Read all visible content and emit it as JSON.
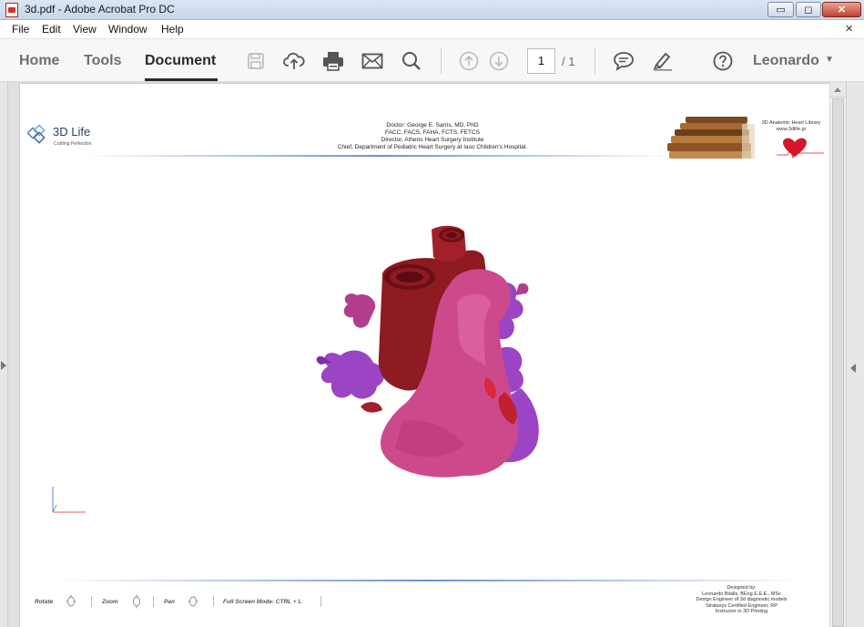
{
  "window": {
    "title": "3d.pdf - Adobe Acrobat Pro DC",
    "minimize_symbol": "▭",
    "maximize_symbol": "◻",
    "close_symbol": "✕"
  },
  "menu": {
    "items": [
      "File",
      "Edit",
      "View",
      "Window",
      "Help"
    ],
    "close_doc": "×"
  },
  "toolbar": {
    "tabs": [
      "Home",
      "Tools",
      "Document"
    ],
    "active_tab": "Document",
    "icons": [
      "save-icon",
      "upload-icon",
      "print-icon",
      "email-icon",
      "search-icon",
      "prev-page-icon",
      "next-page-icon",
      "comment-icon",
      "highlight-icon",
      "help-icon"
    ],
    "page_current": "1",
    "page_total": "/ 1",
    "user": "Leonardo",
    "user_caret": "▼"
  },
  "pdf": {
    "logo_name": "3D Life",
    "logo_tagline": "Crafting Perfection",
    "header_lines": [
      "Doctor: George E. Sarris, MD, PhD",
      "FACC, FACS, FAHA, FCTS, FETCS",
      "Director, Athens Heart Surgery Institute",
      "Chief, Department of Pediatric Heart Surgery at Iaso Children's Hospital."
    ],
    "library_title": "3D Anatomic Heart Library",
    "library_url": "www.3dlife.gr",
    "footer_controls": [
      "Rotate",
      "Zoom",
      "Pan",
      "Full Screen Mode:  CTRL + L"
    ],
    "credits": [
      "Designed by:",
      "Leonardo Bilalis, BEng E.E.E., MSc",
      "Design Engineer of 3d diagnostic models",
      "Stratasys Certified Engineer, RP",
      "Instructor in 3D Printing"
    ]
  },
  "colors": {
    "aorta": "#8e1a22",
    "pulmonary": "#cc4a8c",
    "atria": "#9b45c4",
    "accent_rule": "#6f8fd1"
  }
}
